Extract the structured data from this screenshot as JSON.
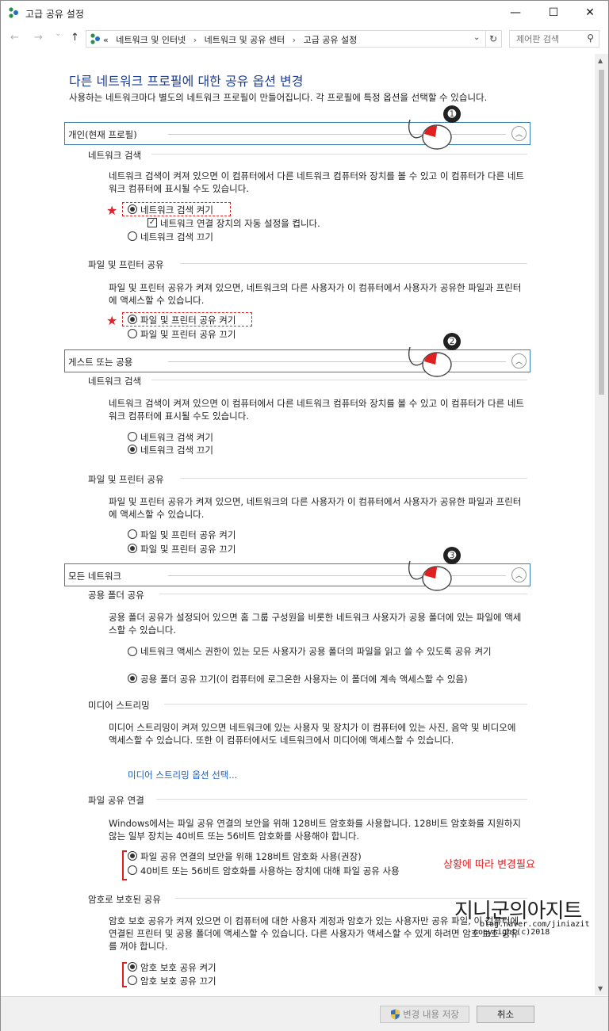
{
  "window": {
    "title": "고급 공유 설정",
    "minimize": "—",
    "maximize": "☐",
    "close": "✕"
  },
  "nav": {
    "back": "←",
    "forward": "→",
    "recent": "⌄",
    "up": "↑",
    "chevrons": "«",
    "breadcrumbs": [
      "네트워크 및 인터넷",
      "네트워크 및 공유 센터",
      "고급 공유 설정"
    ],
    "separator": "›",
    "dropdown": "⌄",
    "refresh": "↻",
    "search_placeholder": "제어판 검색",
    "search_icon": "⚲"
  },
  "heading": "다른 네트워크 프로필에 대한 공유 옵션 변경",
  "intro": "사용하는 네트워크마다 별도의 네트워크 프로필이 만들어집니다. 각 프로필에 특정 옵션을 선택할 수 있습니다.",
  "sections": {
    "private": {
      "label": "개인(현재 프로필)",
      "badge": "➊",
      "discovery": {
        "title": "네트워크 검색",
        "desc": "네트워크 검색이 켜져 있으면 이 컴퓨터에서 다른 네트워크 컴퓨터와 장치를 볼 수 있고 이 컴퓨터가 다른 네트워크 컴퓨터에 표시될 수도 있습니다.",
        "on": "네트워크 검색 켜기",
        "auto": "네트워크 연결 장치의 자동 설정을 켭니다.",
        "off": "네트워크 검색 끄기"
      },
      "sharing": {
        "title": "파일 및 프린터 공유",
        "desc": "파일 및 프린터 공유가 켜져 있으면, 네트워크의 다른 사용자가 이 컴퓨터에서 사용자가 공유한 파일과 프린터에 액세스할 수 있습니다.",
        "on": "파일 및 프린터 공유 켜기",
        "off": "파일 및 프린터 공유 끄기"
      }
    },
    "guest": {
      "label": "게스트 또는 공용",
      "badge": "➋",
      "discovery": {
        "title": "네트워크 검색",
        "desc": "네트워크 검색이 켜져 있으면 이 컴퓨터에서 다른 네트워크 컴퓨터와 장치를 볼 수 있고 이 컴퓨터가 다른 네트워크 컴퓨터에 표시될 수도 있습니다.",
        "on": "네트워크 검색 켜기",
        "off": "네트워크 검색 끄기"
      },
      "sharing": {
        "title": "파일 및 프린터 공유",
        "desc": "파일 및 프린터 공유가 켜져 있으면, 네트워크의 다른 사용자가 이 컴퓨터에서 사용자가 공유한 파일과 프린터에 액세스할 수 있습니다.",
        "on": "파일 및 프린터 공유 켜기",
        "off": "파일 및 프린터 공유 끄기"
      }
    },
    "all": {
      "label": "모든 네트워크",
      "badge": "➌",
      "public_folder": {
        "title": "공용 폴더 공유",
        "desc": "공용 폴더 공유가 설정되어 있으면 홈 그룹 구성원을 비롯한 네트워크 사용자가 공용 폴더에 있는 파일에 액세스할 수 있습니다.",
        "on": "네트워크 액세스 권한이 있는 모든 사용자가 공용 폴더의 파일을 읽고 쓸 수 있도록 공유 켜기",
        "off": "공용 폴더 공유 끄기(이 컴퓨터에 로그온한 사용자는 이 폴더에 계속 액세스할 수 있음)"
      },
      "media": {
        "title": "미디어 스트리밍",
        "desc": "미디어 스트리밍이 켜져 있으면 네트워크에 있는 사용자 및 장치가 이 컴퓨터에 있는 사진, 음악 및 비디오에 액세스할 수 있습니다. 또한 이 컴퓨터에서도 네트워크에서 미디어에 액세스할 수 있습니다.",
        "link": "미디어 스트리밍 옵션 선택..."
      },
      "file_conn": {
        "title": "파일 공유 연결",
        "desc": "Windows에서는 파일 공유 연결의 보안을 위해 128비트 암호화를 사용합니다. 128비트 암호화를 지원하지 않는 일부 장치는 40비트 또는 56비트 암호화를 사용해야 합니다.",
        "opt128": "파일 공유 연결의 보안을 위해 128비트 암호화 사용(권장)",
        "opt40": "40비트 또는 56비트 암호화를 사용하는 장치에 대해 파일 공유 사용",
        "note": "상황에 따라 변경필요"
      },
      "password": {
        "title": "암호로 보호된 공유",
        "desc": "암호 보호 공유가 켜져 있으면 이 컴퓨터에 대한 사용자 계정과 암호가 있는 사용자만 공유 파일, 이 컴퓨터에 연결된 프린터 및 공용 폴더에 액세스할 수 있습니다. 다른 사용자가 액세스할 수 있게 하려면 암호 보호 공유를 꺼야 합니다.",
        "on": "암호 보호 공유 켜기",
        "off": "암호 보호 공유 끄기"
      }
    }
  },
  "footer": {
    "save": "변경 내용 저장",
    "cancel": "취소"
  },
  "watermark": {
    "name": "지니군의아지트",
    "url": "blog.naver.com/jiniazit",
    "copyright": "copyright(c)2018"
  },
  "colors": {
    "heading": "#1e3e96",
    "section_border": "#3c7fb1",
    "annotation_red": "#e02020",
    "link": "#1c5fbf"
  }
}
